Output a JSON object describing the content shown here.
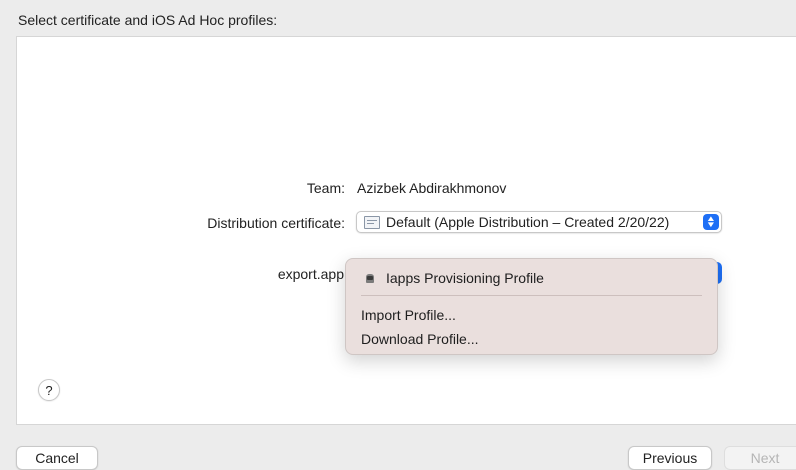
{
  "heading": "Select certificate and iOS Ad Hoc profiles:",
  "team": {
    "label": "Team:",
    "value": "Azizbek Abdirakhmonov"
  },
  "certificate": {
    "label": "Distribution certificate:",
    "value": "Default (Apple Distribution – Created 2/20/22)",
    "icon": "certificate-icon"
  },
  "profile_row": {
    "label": "export.app"
  },
  "menu": {
    "items": [
      {
        "label": "Iapps Provisioning Profile",
        "icon": "provisioning-profile-icon"
      },
      {
        "label": "Import Profile..."
      },
      {
        "label": "Download Profile..."
      }
    ]
  },
  "help": {
    "label": "?"
  },
  "buttons": {
    "cancel": "Cancel",
    "previous": "Previous",
    "next": "Next"
  },
  "colors": {
    "accent": "#1e6ff5",
    "menu_bg": "#eadfdd",
    "window_bg": "#ececec"
  }
}
